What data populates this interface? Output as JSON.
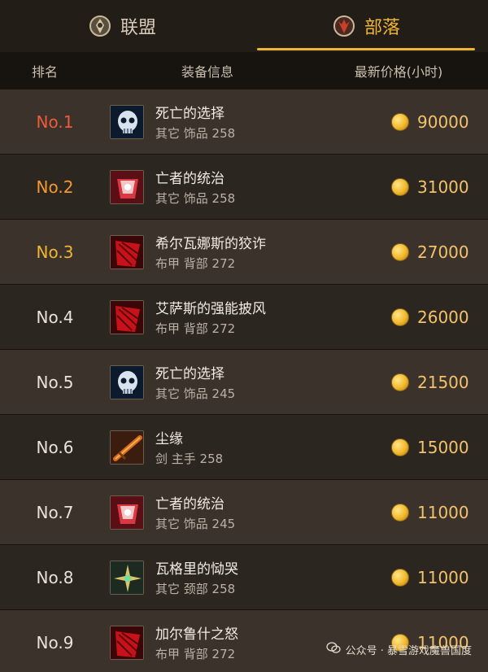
{
  "tabs": {
    "alliance": {
      "label": "联盟",
      "icon": "alliance-emblem-icon"
    },
    "horde": {
      "label": "部落",
      "icon": "horde-emblem-icon"
    },
    "active": "horde"
  },
  "header": {
    "rank": "排名",
    "info": "装备信息",
    "price": "最新价格(小时)"
  },
  "items": [
    {
      "rank": "No.1",
      "name": "死亡的选择",
      "meta": "其它  饰品  258",
      "price": "90000",
      "icon": "skull-trinket-icon"
    },
    {
      "rank": "No.2",
      "name": "亡者的统治",
      "meta": "其它  饰品  258",
      "price": "31000",
      "icon": "red-crystal-icon"
    },
    {
      "rank": "No.3",
      "name": "希尔瓦娜斯的狡诈",
      "meta": "布甲  背部  272",
      "price": "27000",
      "icon": "red-cloak-icon"
    },
    {
      "rank": "No.4",
      "name": "艾萨斯的强能披风",
      "meta": "布甲  背部  272",
      "price": "26000",
      "icon": "red-cloak-icon"
    },
    {
      "rank": "No.5",
      "name": "死亡的选择",
      "meta": "其它  饰品  245",
      "price": "21500",
      "icon": "skull-trinket-icon"
    },
    {
      "rank": "No.6",
      "name": "尘缘",
      "meta": "剑  主手  258",
      "price": "15000",
      "icon": "sword-icon"
    },
    {
      "rank": "No.7",
      "name": "亡者的统治",
      "meta": "其它  饰品  245",
      "price": "11000",
      "icon": "red-crystal-icon"
    },
    {
      "rank": "No.8",
      "name": "瓦格里的恸哭",
      "meta": "其它  颈部  258",
      "price": "11000",
      "icon": "amulet-icon"
    },
    {
      "rank": "No.9",
      "name": "加尔鲁什之怒",
      "meta": "布甲  背部  272",
      "price": "11000",
      "icon": "red-cloak-icon"
    }
  ],
  "watermark": "公众号 · 暴雪游戏魔兽国度",
  "colors": {
    "background": "#1f1a15",
    "accent_gold": "#f1b631",
    "rank1": "#ef5a3a",
    "rank2": "#f49a2d",
    "rank3": "#f1b631",
    "row_odd": "#3a322b",
    "row_even": "#2c2621"
  }
}
